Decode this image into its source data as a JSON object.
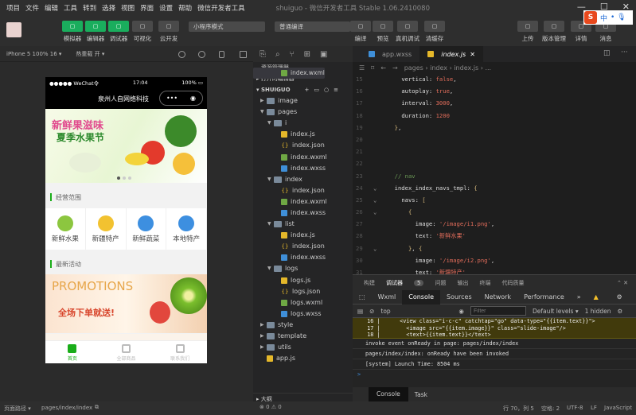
{
  "menu": {
    "items": [
      "项目",
      "文件",
      "编辑",
      "工具",
      "转到",
      "选择",
      "视图",
      "界面",
      "设置",
      "帮助",
      "微信开发者工具"
    ],
    "title": "shuiguo - 微信开发者工具 Stable 1.06.2410080"
  },
  "toolbar": {
    "left": [
      {
        "label": "模拟器",
        "icon": "phone-icon",
        "active": true
      },
      {
        "label": "编辑器",
        "icon": "code-icon",
        "active": true
      },
      {
        "label": "调试器",
        "icon": "debug-icon",
        "active": true
      },
      {
        "label": "可视化",
        "icon": "layout-icon"
      },
      {
        "label": "云开发",
        "icon": "cloud-icon"
      }
    ],
    "mode_select": "小程序模式",
    "compile_select": "普通编译",
    "middle": [
      {
        "label": "编译",
        "icon": "refresh-icon"
      },
      {
        "label": "预览",
        "icon": "eye-icon"
      },
      {
        "label": "真机调试",
        "icon": "bug-icon"
      },
      {
        "label": "清缓存",
        "icon": "layers-icon"
      }
    ],
    "right": [
      {
        "label": "上传",
        "icon": "upload-icon"
      },
      {
        "label": "版本管理",
        "icon": "branch-icon"
      },
      {
        "label": "详情",
        "icon": "menu-icon"
      },
      {
        "label": "消息",
        "icon": "bell-icon"
      }
    ]
  },
  "ime": {
    "logo": "S",
    "lang": "中"
  },
  "simulator": {
    "device": "iPhone 5 100% 16 ▾",
    "hotreload": "热重载 开 ▾",
    "status": {
      "carrier": "●●●●● WeChat令",
      "time": "17:04",
      "battery": "100%"
    },
    "nav_title": "泉州人自网络科技",
    "banner": {
      "line1": "新鲜果滋味",
      "line2": "夏季水果节",
      "dots": 3,
      "active_dot": 0
    },
    "section1": "经营范围",
    "navs": [
      {
        "text": "新鲜水果",
        "color": "#8cc63f"
      },
      {
        "text": "新疆特产",
        "color": "#f2c230"
      },
      {
        "text": "新鲜蔬菜",
        "color": "#3d8fe0"
      },
      {
        "text": "本地特产",
        "color": "#3d8fe0"
      }
    ],
    "section2": "最新活动",
    "promo": {
      "title": "PROMOTIONS",
      "headline": "全场下单就送!"
    },
    "tabs": [
      {
        "label": "首页",
        "active": true
      },
      {
        "label": "全部商品"
      },
      {
        "label": "联系我们"
      }
    ]
  },
  "explorer": {
    "title": "资源管理器",
    "open_editors": "打开的编辑器",
    "project": "SHUIGUO",
    "tree": [
      {
        "name": "image",
        "type": "dir",
        "level": 1,
        "open": false
      },
      {
        "name": "pages",
        "type": "dir",
        "level": 1,
        "open": true
      },
      {
        "name": "i",
        "type": "dir",
        "level": 2,
        "open": true
      },
      {
        "name": "index.js",
        "type": "js",
        "level": 3
      },
      {
        "name": "index.json",
        "type": "json",
        "level": 3
      },
      {
        "name": "index.wxml",
        "type": "wxml",
        "level": 3
      },
      {
        "name": "index.wxss",
        "type": "wxss",
        "level": 3
      },
      {
        "name": "index",
        "type": "dir",
        "level": 2,
        "open": true
      },
      {
        "name": "index.js",
        "type": "js",
        "level": 3,
        "selected": true
      },
      {
        "name": "index.json",
        "type": "json",
        "level": 3
      },
      {
        "name": "index.wxml",
        "type": "wxml",
        "level": 3
      },
      {
        "name": "index.wxss",
        "type": "wxss",
        "level": 3
      },
      {
        "name": "list",
        "type": "dir",
        "level": 2,
        "open": true
      },
      {
        "name": "index.js",
        "type": "js",
        "level": 3
      },
      {
        "name": "index.json",
        "type": "json",
        "level": 3
      },
      {
        "name": "index.wxml",
        "type": "wxml",
        "level": 3,
        "selected": true
      },
      {
        "name": "index.wxss",
        "type": "wxss",
        "level": 3
      },
      {
        "name": "logs",
        "type": "dir",
        "level": 2,
        "open": true
      },
      {
        "name": "logs.js",
        "type": "js",
        "level": 3
      },
      {
        "name": "logs.json",
        "type": "json",
        "level": 3
      },
      {
        "name": "logs.wxml",
        "type": "wxml",
        "level": 3
      },
      {
        "name": "logs.wxss",
        "type": "wxss",
        "level": 3
      },
      {
        "name": "style",
        "type": "dir",
        "level": 1,
        "open": false
      },
      {
        "name": "template",
        "type": "dir",
        "level": 1,
        "open": false
      },
      {
        "name": "utils",
        "type": "dir",
        "level": 1,
        "open": false
      },
      {
        "name": "app.js",
        "type": "js",
        "level": 1
      }
    ],
    "outline": "大纲",
    "errors": "0",
    "warnings": "0"
  },
  "editor": {
    "tabs": [
      {
        "label": "app.wxss",
        "type": "wxss"
      },
      {
        "label": "index.js",
        "type": "js",
        "active": true
      }
    ],
    "breadcrumb": [
      "pages",
      "index",
      "index.js",
      "..."
    ],
    "lines": [
      {
        "n": 15,
        "i": 2,
        "t": [
          [
            "k",
            "vertical: "
          ],
          [
            "n",
            "false"
          ],
          [
            "k",
            ","
          ]
        ]
      },
      {
        "n": 16,
        "i": 2,
        "t": [
          [
            "k",
            "autoplay: "
          ],
          [
            "n",
            "true"
          ],
          [
            "k",
            ","
          ]
        ]
      },
      {
        "n": 17,
        "i": 2,
        "t": [
          [
            "k",
            "interval: "
          ],
          [
            "n",
            "3000"
          ],
          [
            "k",
            ","
          ]
        ]
      },
      {
        "n": 18,
        "i": 2,
        "t": [
          [
            "k",
            "duration: "
          ],
          [
            "n",
            "1200"
          ]
        ]
      },
      {
        "n": 19,
        "i": 1,
        "t": [
          [
            "p",
            "}"
          ],
          [
            "k",
            ","
          ]
        ]
      },
      {
        "n": 20,
        "i": 0,
        "t": []
      },
      {
        "n": 21,
        "i": 0,
        "t": []
      },
      {
        "n": 22,
        "i": 0,
        "t": []
      },
      {
        "n": 23,
        "i": 1,
        "t": [
          [
            "c",
            "// nav"
          ]
        ]
      },
      {
        "n": 24,
        "i": 1,
        "f": true,
        "t": [
          [
            "k",
            "index_index_navs_tmpl: "
          ],
          [
            "p",
            "{"
          ]
        ]
      },
      {
        "n": 25,
        "i": 2,
        "f": true,
        "t": [
          [
            "k",
            "navs: "
          ],
          [
            "p",
            "["
          ]
        ]
      },
      {
        "n": 26,
        "i": 3,
        "f": true,
        "t": [
          [
            "p",
            "{"
          ]
        ]
      },
      {
        "n": 27,
        "i": 4,
        "t": [
          [
            "k",
            "image: "
          ],
          [
            "s",
            "'/image/i1.png'"
          ],
          [
            "k",
            ","
          ]
        ]
      },
      {
        "n": 28,
        "i": 4,
        "t": [
          [
            "k",
            "text: "
          ],
          [
            "s",
            "'新鲜水果'"
          ]
        ]
      },
      {
        "n": 29,
        "i": 3,
        "f": true,
        "t": [
          [
            "p",
            "}"
          ],
          [
            "k",
            ", "
          ],
          [
            "p",
            "{"
          ]
        ]
      },
      {
        "n": 30,
        "i": 4,
        "t": [
          [
            "k",
            "image: "
          ],
          [
            "s",
            "'/image/i2.png'"
          ],
          [
            "k",
            ","
          ]
        ]
      },
      {
        "n": 31,
        "i": 4,
        "t": [
          [
            "k",
            "text: "
          ],
          [
            "s",
            "'新疆特产'"
          ]
        ]
      }
    ]
  },
  "devtools": {
    "top_tabs": [
      "构建",
      "调试器",
      "问题",
      "输出",
      "终端",
      "代码质量"
    ],
    "debugger_badge": "5",
    "tabs": [
      "Wxml",
      "Console",
      "Sources",
      "Network",
      "Performance",
      "»"
    ],
    "active_tab": "Console",
    "warn_count": "5",
    "context": "top",
    "filter_placeholder": "Filter",
    "levels": "Default levels ▾",
    "hidden": "1 hidden",
    "warning_lines": [
      "  16 |      <view class=\"i-c-c\" catchtap=\"go\" data-type=\"{{item.text}}\">",
      "  17 |        <image src=\"{{item.image}}\" class=\"slide-image\"/>",
      "  18 |        <text>{{item.text}}</text>"
    ],
    "logs": [
      "invoke event onReady in page: pages/index/index",
      "pages/index/index: onReady have been invoked",
      "[system] Launch Time: 8504 ms"
    ],
    "prompt": ">",
    "drawer_tabs": [
      "Console",
      "Task"
    ]
  },
  "statusbar": {
    "page_path_label": "页面路径 ▾",
    "page_path": "pages/index/index",
    "position": "行 70，列 5",
    "spaces": "空格: 2",
    "encoding": "UTF-8",
    "eol": "LF",
    "language": "JavaScript"
  }
}
